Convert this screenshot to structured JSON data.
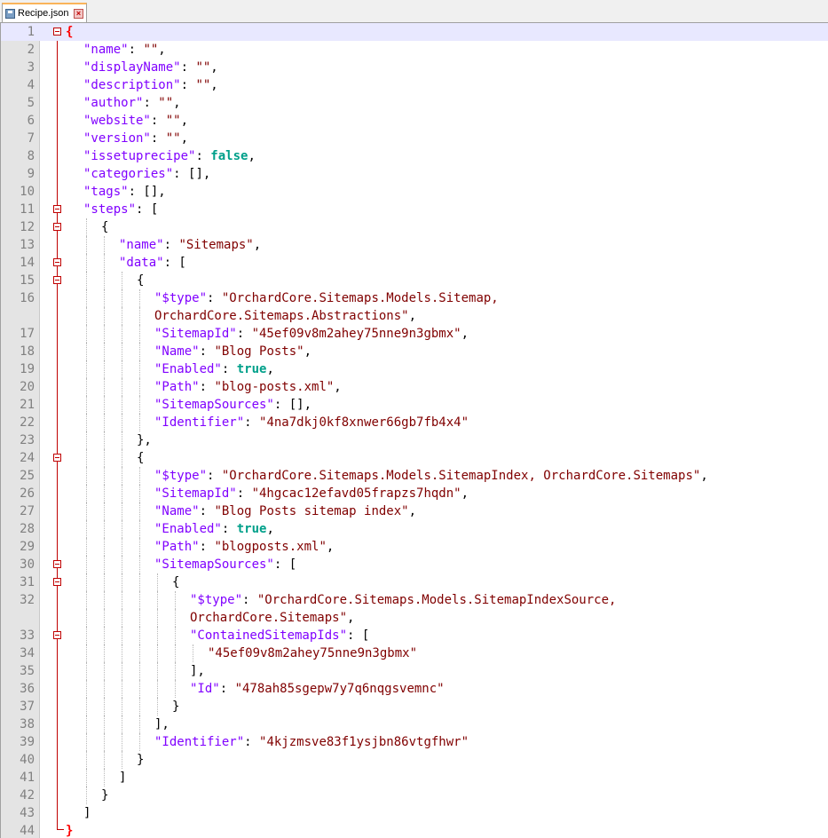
{
  "tab": {
    "title": "Recipe.json",
    "save_icon": "save-icon",
    "close_icon": "close-icon"
  },
  "editor": {
    "current_line": 1,
    "lines": [
      {
        "n": "1",
        "indent": 0,
        "fold": true,
        "t": [
          [
            "ob",
            "{"
          ]
        ]
      },
      {
        "n": "2",
        "indent": 1,
        "t": [
          [
            "k",
            "\"name\""
          ],
          [
            "p",
            ": "
          ],
          [
            "s",
            "\"\""
          ],
          [
            "p",
            ","
          ]
        ]
      },
      {
        "n": "3",
        "indent": 1,
        "t": [
          [
            "k",
            "\"displayName\""
          ],
          [
            "p",
            ": "
          ],
          [
            "s",
            "\"\""
          ],
          [
            "p",
            ","
          ]
        ]
      },
      {
        "n": "4",
        "indent": 1,
        "t": [
          [
            "k",
            "\"description\""
          ],
          [
            "p",
            ": "
          ],
          [
            "s",
            "\"\""
          ],
          [
            "p",
            ","
          ]
        ]
      },
      {
        "n": "5",
        "indent": 1,
        "t": [
          [
            "k",
            "\"author\""
          ],
          [
            "p",
            ": "
          ],
          [
            "s",
            "\"\""
          ],
          [
            "p",
            ","
          ]
        ]
      },
      {
        "n": "6",
        "indent": 1,
        "t": [
          [
            "k",
            "\"website\""
          ],
          [
            "p",
            ": "
          ],
          [
            "s",
            "\"\""
          ],
          [
            "p",
            ","
          ]
        ]
      },
      {
        "n": "7",
        "indent": 1,
        "t": [
          [
            "k",
            "\"version\""
          ],
          [
            "p",
            ": "
          ],
          [
            "s",
            "\"\""
          ],
          [
            "p",
            ","
          ]
        ]
      },
      {
        "n": "8",
        "indent": 1,
        "t": [
          [
            "k",
            "\"issetuprecipe\""
          ],
          [
            "p",
            ": "
          ],
          [
            "b",
            "false"
          ],
          [
            "p",
            ","
          ]
        ]
      },
      {
        "n": "9",
        "indent": 1,
        "t": [
          [
            "k",
            "\"categories\""
          ],
          [
            "p",
            ": [],"
          ]
        ]
      },
      {
        "n": "10",
        "indent": 1,
        "t": [
          [
            "k",
            "\"tags\""
          ],
          [
            "p",
            ": [],"
          ]
        ]
      },
      {
        "n": "11",
        "indent": 1,
        "fold": true,
        "t": [
          [
            "k",
            "\"steps\""
          ],
          [
            "p",
            ": ["
          ]
        ]
      },
      {
        "n": "12",
        "indent": 2,
        "fold": true,
        "t": [
          [
            "p",
            "{"
          ]
        ]
      },
      {
        "n": "13",
        "indent": 3,
        "t": [
          [
            "k",
            "\"name\""
          ],
          [
            "p",
            ": "
          ],
          [
            "s",
            "\"Sitemaps\""
          ],
          [
            "p",
            ","
          ]
        ]
      },
      {
        "n": "14",
        "indent": 3,
        "fold": true,
        "t": [
          [
            "k",
            "\"data\""
          ],
          [
            "p",
            ": ["
          ]
        ]
      },
      {
        "n": "15",
        "indent": 4,
        "fold": true,
        "t": [
          [
            "p",
            "{"
          ]
        ]
      },
      {
        "n": "16",
        "indent": 5,
        "t": [
          [
            "k",
            "\"$type\""
          ],
          [
            "p",
            ": "
          ],
          [
            "s",
            "\"OrchardCore.Sitemaps.Models.Sitemap,"
          ]
        ]
      },
      {
        "n": "",
        "indent": 5,
        "t": [
          [
            "s",
            "OrchardCore.Sitemaps.Abstractions\""
          ],
          [
            "p",
            ","
          ]
        ]
      },
      {
        "n": "17",
        "indent": 5,
        "t": [
          [
            "k",
            "\"SitemapId\""
          ],
          [
            "p",
            ": "
          ],
          [
            "s",
            "\"45ef09v8m2ahey75nne9n3gbmx\""
          ],
          [
            "p",
            ","
          ]
        ]
      },
      {
        "n": "18",
        "indent": 5,
        "t": [
          [
            "k",
            "\"Name\""
          ],
          [
            "p",
            ": "
          ],
          [
            "s",
            "\"Blog Posts\""
          ],
          [
            "p",
            ","
          ]
        ]
      },
      {
        "n": "19",
        "indent": 5,
        "t": [
          [
            "k",
            "\"Enabled\""
          ],
          [
            "p",
            ": "
          ],
          [
            "b",
            "true"
          ],
          [
            "p",
            ","
          ]
        ]
      },
      {
        "n": "20",
        "indent": 5,
        "t": [
          [
            "k",
            "\"Path\""
          ],
          [
            "p",
            ": "
          ],
          [
            "s",
            "\"blog-posts.xml\""
          ],
          [
            "p",
            ","
          ]
        ]
      },
      {
        "n": "21",
        "indent": 5,
        "t": [
          [
            "k",
            "\"SitemapSources\""
          ],
          [
            "p",
            ": [],"
          ]
        ]
      },
      {
        "n": "22",
        "indent": 5,
        "t": [
          [
            "k",
            "\"Identifier\""
          ],
          [
            "p",
            ": "
          ],
          [
            "s",
            "\"4na7dkj0kf8xnwer66gb7fb4x4\""
          ]
        ]
      },
      {
        "n": "23",
        "indent": 4,
        "t": [
          [
            "p",
            "},"
          ]
        ]
      },
      {
        "n": "24",
        "indent": 4,
        "fold": true,
        "t": [
          [
            "p",
            "{"
          ]
        ]
      },
      {
        "n": "25",
        "indent": 5,
        "t": [
          [
            "k",
            "\"$type\""
          ],
          [
            "p",
            ": "
          ],
          [
            "s",
            "\"OrchardCore.Sitemaps.Models.SitemapIndex, OrchardCore.Sitemaps\""
          ],
          [
            "p",
            ","
          ]
        ]
      },
      {
        "n": "26",
        "indent": 5,
        "t": [
          [
            "k",
            "\"SitemapId\""
          ],
          [
            "p",
            ": "
          ],
          [
            "s",
            "\"4hgcac12efavd05frapzs7hqdn\""
          ],
          [
            "p",
            ","
          ]
        ]
      },
      {
        "n": "27",
        "indent": 5,
        "t": [
          [
            "k",
            "\"Name\""
          ],
          [
            "p",
            ": "
          ],
          [
            "s",
            "\"Blog Posts sitemap index\""
          ],
          [
            "p",
            ","
          ]
        ]
      },
      {
        "n": "28",
        "indent": 5,
        "t": [
          [
            "k",
            "\"Enabled\""
          ],
          [
            "p",
            ": "
          ],
          [
            "b",
            "true"
          ],
          [
            "p",
            ","
          ]
        ]
      },
      {
        "n": "29",
        "indent": 5,
        "t": [
          [
            "k",
            "\"Path\""
          ],
          [
            "p",
            ": "
          ],
          [
            "s",
            "\"blogposts.xml\""
          ],
          [
            "p",
            ","
          ]
        ]
      },
      {
        "n": "30",
        "indent": 5,
        "fold": true,
        "t": [
          [
            "k",
            "\"SitemapSources\""
          ],
          [
            "p",
            ": ["
          ]
        ]
      },
      {
        "n": "31",
        "indent": 6,
        "fold": true,
        "t": [
          [
            "p",
            "{"
          ]
        ]
      },
      {
        "n": "32",
        "indent": 7,
        "t": [
          [
            "k",
            "\"$type\""
          ],
          [
            "p",
            ": "
          ],
          [
            "s",
            "\"OrchardCore.Sitemaps.Models.SitemapIndexSource,"
          ]
        ]
      },
      {
        "n": "",
        "indent": 7,
        "t": [
          [
            "s",
            "OrchardCore.Sitemaps\""
          ],
          [
            "p",
            ","
          ]
        ]
      },
      {
        "n": "33",
        "indent": 7,
        "fold": true,
        "t": [
          [
            "k",
            "\"ContainedSitemapIds\""
          ],
          [
            "p",
            ": ["
          ]
        ]
      },
      {
        "n": "34",
        "indent": 8,
        "t": [
          [
            "s",
            "\"45ef09v8m2ahey75nne9n3gbmx\""
          ]
        ]
      },
      {
        "n": "35",
        "indent": 7,
        "t": [
          [
            "p",
            "],"
          ]
        ]
      },
      {
        "n": "36",
        "indent": 7,
        "t": [
          [
            "k",
            "\"Id\""
          ],
          [
            "p",
            ": "
          ],
          [
            "s",
            "\"478ah85sgepw7y7q6nqgsvemnc\""
          ]
        ]
      },
      {
        "n": "37",
        "indent": 6,
        "t": [
          [
            "p",
            "}"
          ]
        ]
      },
      {
        "n": "38",
        "indent": 5,
        "t": [
          [
            "p",
            "],"
          ]
        ]
      },
      {
        "n": "39",
        "indent": 5,
        "t": [
          [
            "k",
            "\"Identifier\""
          ],
          [
            "p",
            ": "
          ],
          [
            "s",
            "\"4kjzmsve83f1ysjbn86vtgfhwr\""
          ]
        ]
      },
      {
        "n": "40",
        "indent": 4,
        "t": [
          [
            "p",
            "}"
          ]
        ]
      },
      {
        "n": "41",
        "indent": 3,
        "t": [
          [
            "p",
            "]"
          ]
        ]
      },
      {
        "n": "42",
        "indent": 2,
        "t": [
          [
            "p",
            "}"
          ]
        ]
      },
      {
        "n": "43",
        "indent": 1,
        "t": [
          [
            "p",
            "]"
          ]
        ]
      },
      {
        "n": "44",
        "indent": 0,
        "t": [
          [
            "ob",
            "}"
          ]
        ]
      }
    ]
  }
}
